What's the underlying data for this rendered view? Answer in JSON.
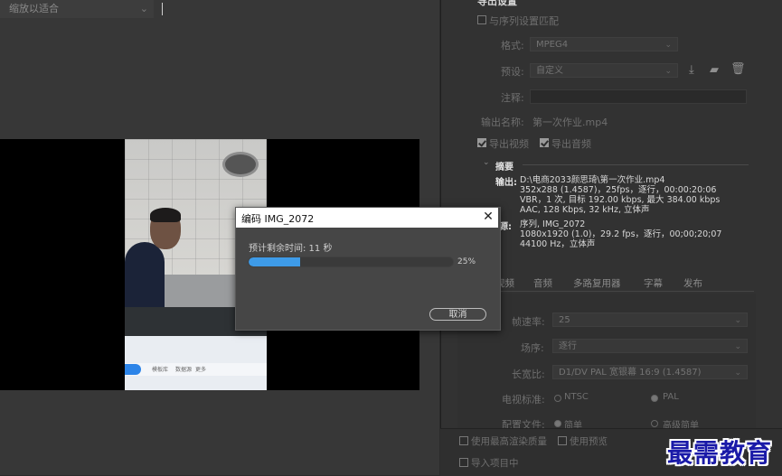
{
  "monitor": {
    "fit_label": "缩放以适合",
    "screen_texts": [
      "模板库",
      "数据源",
      "更多"
    ]
  },
  "export_settings": {
    "title": "导出设置",
    "match_sequence": "与序列设置匹配",
    "format_label": "格式:",
    "format_value": "MPEG4",
    "preset_label": "预设:",
    "preset_value": "自定义",
    "comment_label": "注释:",
    "output_name_label": "输出名称:",
    "output_name_value": "第一次作业.mp4",
    "export_video": "导出视频",
    "export_audio": "导出音频",
    "summary_label": "摘要",
    "output_label": "输出:",
    "output_lines": [
      "D:\\电商2033颜思琦\\第一次作业.mp4",
      "352x288 (1.4587)，25fps，逐行，00:00:20:06",
      "VBR，1 次, 目标 192.00 kbps, 最大 384.00 kbps",
      "AAC, 128 Kbps, 32  kHz, 立体声"
    ],
    "source_label": "源:",
    "source_lines": [
      "序列, IMG_2072",
      "1080x1920 (1.0)，29.2 fps，逐行，00;00;20;07",
      "44100 Hz，立体声"
    ]
  },
  "tabs": [
    "视频",
    "音频",
    "多路复用器",
    "字幕",
    "发布"
  ],
  "video_settings": {
    "frame_rate_label": "帧速率:",
    "frame_rate_value": "25",
    "field_order_label": "场序:",
    "field_order_value": "逐行",
    "aspect_label": "长宽比:",
    "aspect_value": "D1/DV PAL 宽银幕 16:9 (1.4587)",
    "tv_standard_label": "电视标准:",
    "tv_ntsc": "NTSC",
    "tv_pal": "PAL",
    "profile_label": "配置文件:",
    "profile_simple": "简单",
    "profile_advanced": "高级简单"
  },
  "bottom": {
    "max_render_quality": "使用最高渲染质量",
    "use_previews": "使用预览",
    "import_into_project": "导入项目中"
  },
  "watermark": "最需教育",
  "dialog": {
    "title": "编码 IMG_2072",
    "time_remaining": "预计剩余时间: 11 秒",
    "progress_percent": 25,
    "progress_label": "25%",
    "cancel_label": "取消",
    "close_glyph": "✕"
  }
}
